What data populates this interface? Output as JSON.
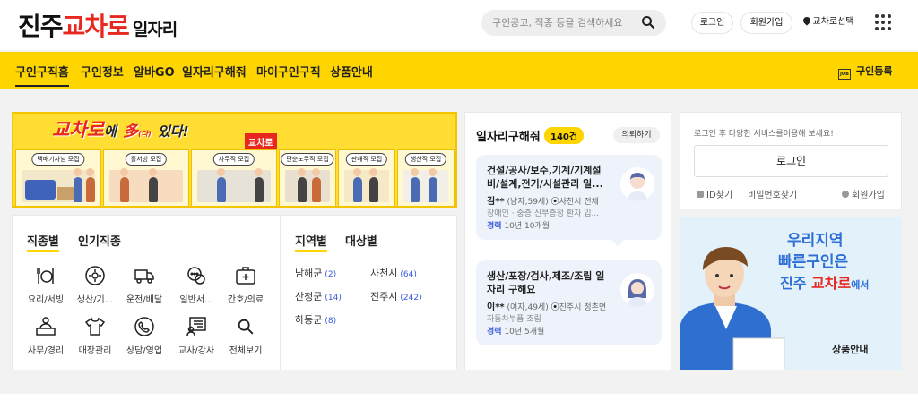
{
  "header": {
    "logo_1": "진주",
    "logo_2": "교차로",
    "logo_3": "일자리",
    "search_placeholder": "구인공고, 직종 등을 검색하세요",
    "login_label": "로그인",
    "join_label": "회원가입",
    "region_label": "교차로선택"
  },
  "nav": {
    "items": [
      "구인구직홈",
      "구인정보",
      "알바GO",
      "일자리구해줘",
      "마이구인구직",
      "상품안내"
    ],
    "register_label": "구인등록",
    "register_icon_text": "JOB"
  },
  "banner": {
    "title_1": "교차로",
    "title_2": "에",
    "title_3": "多",
    "title_4": "(다)",
    "title_5": "있다!",
    "badge": "교차로",
    "panels": [
      "택배기사님 모집",
      "홀서빙 모집",
      "사무직 모집",
      "단순노무직 모집",
      "판매직 모집",
      "생산직 모집"
    ]
  },
  "categories": {
    "tab_job": "직종별",
    "tab_popular": "인기직종",
    "items": [
      "요리/서빙",
      "생산/기...",
      "운전/배달",
      "일반서...",
      "간호/의료",
      "사무/경리",
      "매장관리",
      "상담/영업",
      "교사/강사",
      "전체보기"
    ],
    "tab_region": "지역별",
    "tab_target": "대상별",
    "regions": [
      {
        "name": "남해군",
        "count": "(2)"
      },
      {
        "name": "사천시",
        "count": "(64)"
      },
      {
        "name": "산청군",
        "count": "(14)"
      },
      {
        "name": "진주시",
        "count": "(242)"
      },
      {
        "name": "하동군",
        "count": "(8)"
      }
    ]
  },
  "requests": {
    "title": "일자리구해줘",
    "count": "140건",
    "button": "의뢰하기",
    "cards": [
      {
        "title": "건설/공사/보수,기계/기계설비/설계,전기/시설관리 일...",
        "name": "김**",
        "info": "(남자,59세)",
        "location": "사천시 전체",
        "desc": "장애인 · 중증 신부증정 환자 입...",
        "exp_label": "경력",
        "exp_value": "10년 10개월"
      },
      {
        "title": "생산/포장/검사,제조/조립 일자리 구해요",
        "name": "이**",
        "info": "(여자,49세)",
        "location": "진주시 정촌면",
        "desc": "자동차부품 조립",
        "exp_label": "경력",
        "exp_value": "10년 5개월"
      }
    ]
  },
  "login_panel": {
    "message": "로그인 후 다양한 서비스를이용해 보세요!",
    "login_button": "로그인",
    "find_id": "ID찾기",
    "find_pw": "비밀번호찾기",
    "join": "회원가입"
  },
  "ad": {
    "line1": "우리지역",
    "line2": "빠른구인은",
    "line3a": "진주 ",
    "line3b": "교차로",
    "line3c": "에서",
    "button": "상품안내"
  },
  "colors": {
    "accent_yellow": "#ffd500",
    "brand_red": "#e8281e",
    "link_blue": "#3a5bd9",
    "ad_blue": "#2d6fd6"
  }
}
